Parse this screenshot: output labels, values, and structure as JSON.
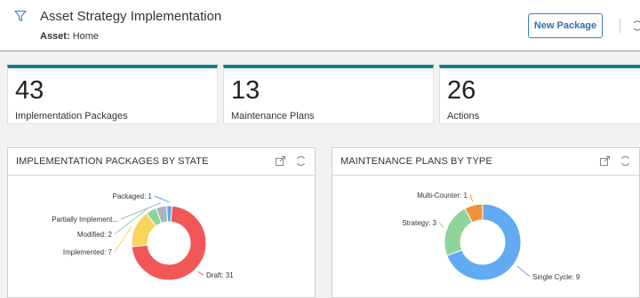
{
  "header": {
    "title": "Asset Strategy Implementation",
    "asset_label": "Asset:",
    "asset_value": "Home",
    "new_package_label": "New Package"
  },
  "kpis": [
    {
      "value": "43",
      "label": "Implementation Packages"
    },
    {
      "value": "13",
      "label": "Maintenance Plans"
    },
    {
      "value": "26",
      "label": "Actions"
    }
  ],
  "panels": {
    "state": {
      "title": "IMPLEMENTATION PACKAGES BY STATE"
    },
    "type": {
      "title": "MAINTENANCE PLANS BY TYPE"
    }
  },
  "colors": {
    "accent": "#127b8c",
    "button": "#2f6fb0"
  },
  "chart_data": [
    {
      "type": "pie",
      "title": "IMPLEMENTATION PACKAGES BY STATE",
      "slices": [
        {
          "label": "Packaged",
          "value": 1,
          "text": "Packaged: 1",
          "color": "#5aa9e6"
        },
        {
          "label": "Draft",
          "value": 31,
          "text": "Draft: 31",
          "color": "#f25757"
        },
        {
          "label": "Implemented",
          "value": 7,
          "text": "Implemented: 7",
          "color": "#f7d65a"
        },
        {
          "label": "Modified",
          "value": 2,
          "text": "Modified: 2",
          "color": "#8fd49a"
        },
        {
          "label": "Partially Implemented",
          "value": 2,
          "text": "Partially Implement...",
          "color": "#a7b5c2"
        }
      ]
    },
    {
      "type": "pie",
      "title": "MAINTENANCE PLANS BY TYPE",
      "slices": [
        {
          "label": "Single Cycle",
          "value": 9,
          "text": "Single Cycle: 9",
          "color": "#62aaf2"
        },
        {
          "label": "Strategy",
          "value": 3,
          "text": "Strategy: 3",
          "color": "#8fd49a"
        },
        {
          "label": "Multi-Counter",
          "value": 1,
          "text": "Multi-Counter: 1",
          "color": "#f5913b"
        }
      ]
    }
  ]
}
